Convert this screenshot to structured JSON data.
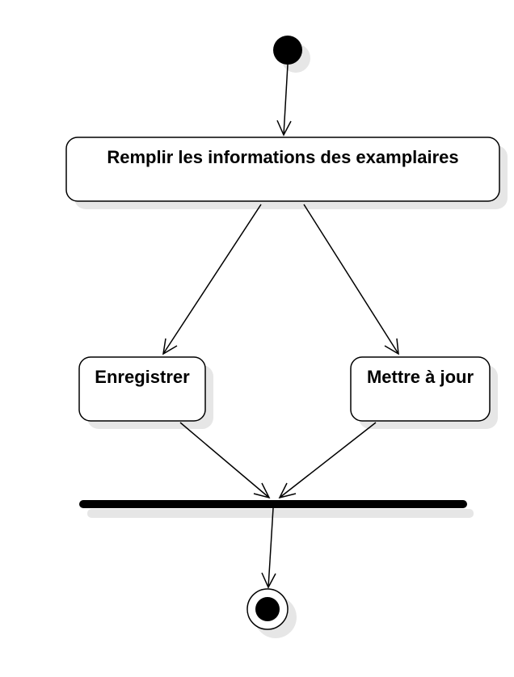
{
  "diagram": {
    "type": "uml-activity-diagram",
    "actions": {
      "fill_info": "Remplir les informations des examplaires",
      "save": "Enregistrer",
      "update": "Mettre à jour"
    },
    "nodes": [
      "initial-node",
      "action-fill-info",
      "action-save",
      "action-update",
      "join-bar",
      "final-node"
    ],
    "edges": [
      {
        "from": "initial-node",
        "to": "action-fill-info"
      },
      {
        "from": "action-fill-info",
        "to": "action-save"
      },
      {
        "from": "action-fill-info",
        "to": "action-update"
      },
      {
        "from": "action-save",
        "to": "join-bar"
      },
      {
        "from": "action-update",
        "to": "join-bar"
      },
      {
        "from": "join-bar",
        "to": "final-node"
      }
    ],
    "colors": {
      "stroke": "#000000",
      "fill": "#ffffff",
      "shadow": "#e6e6e6"
    }
  }
}
